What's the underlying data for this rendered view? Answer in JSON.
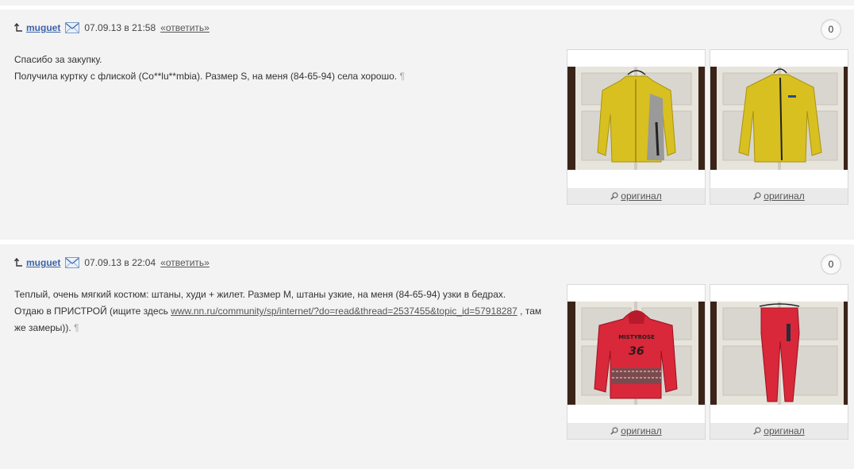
{
  "comments": [
    {
      "author": "muguet",
      "datetime": "07.09.13 в 21:58",
      "reply_label": "«ответить»",
      "votes": "0",
      "lines": [
        "Спасибо за закупку.",
        "Получила куртку с флиской (Co**lu**mbia). Размер S, на меня (84-65-94) села хорошо."
      ],
      "pilcrow": "¶",
      "images": [
        {
          "subject": "yellow jacket with grey panels",
          "link": "оригинал"
        },
        {
          "subject": "yellow fleece jacket",
          "link": "оригинал"
        }
      ]
    },
    {
      "author": "muguet",
      "datetime": "07.09.13 в 22:04",
      "reply_label": "«ответить»",
      "votes": "0",
      "line1": "Теплый, очень мягкий костюм: штаны, худи + жилет. Размер М, штаны узкие, на меня (84-65-94) узки в бедрах.",
      "line2_before": "Отдаю в ПРИСТРОЙ (ищите здесь ",
      "line2_link": "www.nn.ru/community/sp/internet/?do=read&thread=2537455&topic_id=57918287",
      "line2_after": " , там",
      "line3": "же замеры)).",
      "pilcrow": "¶",
      "images": [
        {
          "subject": "red hoodie",
          "print_top": "MISTYROSE",
          "print_num": "36",
          "link": "оригинал"
        },
        {
          "subject": "red trousers",
          "link": "оригинал"
        }
      ]
    }
  ],
  "colors": {
    "background": "#f3f3f3",
    "author_link": "#3b63a8",
    "jacket_yellow": "#d8c020",
    "suit_red": "#d8283a"
  },
  "icons": {
    "reply_arrow": "arrow-up-left-icon",
    "mail": "envelope-icon",
    "zoom": "magnifier-icon"
  }
}
